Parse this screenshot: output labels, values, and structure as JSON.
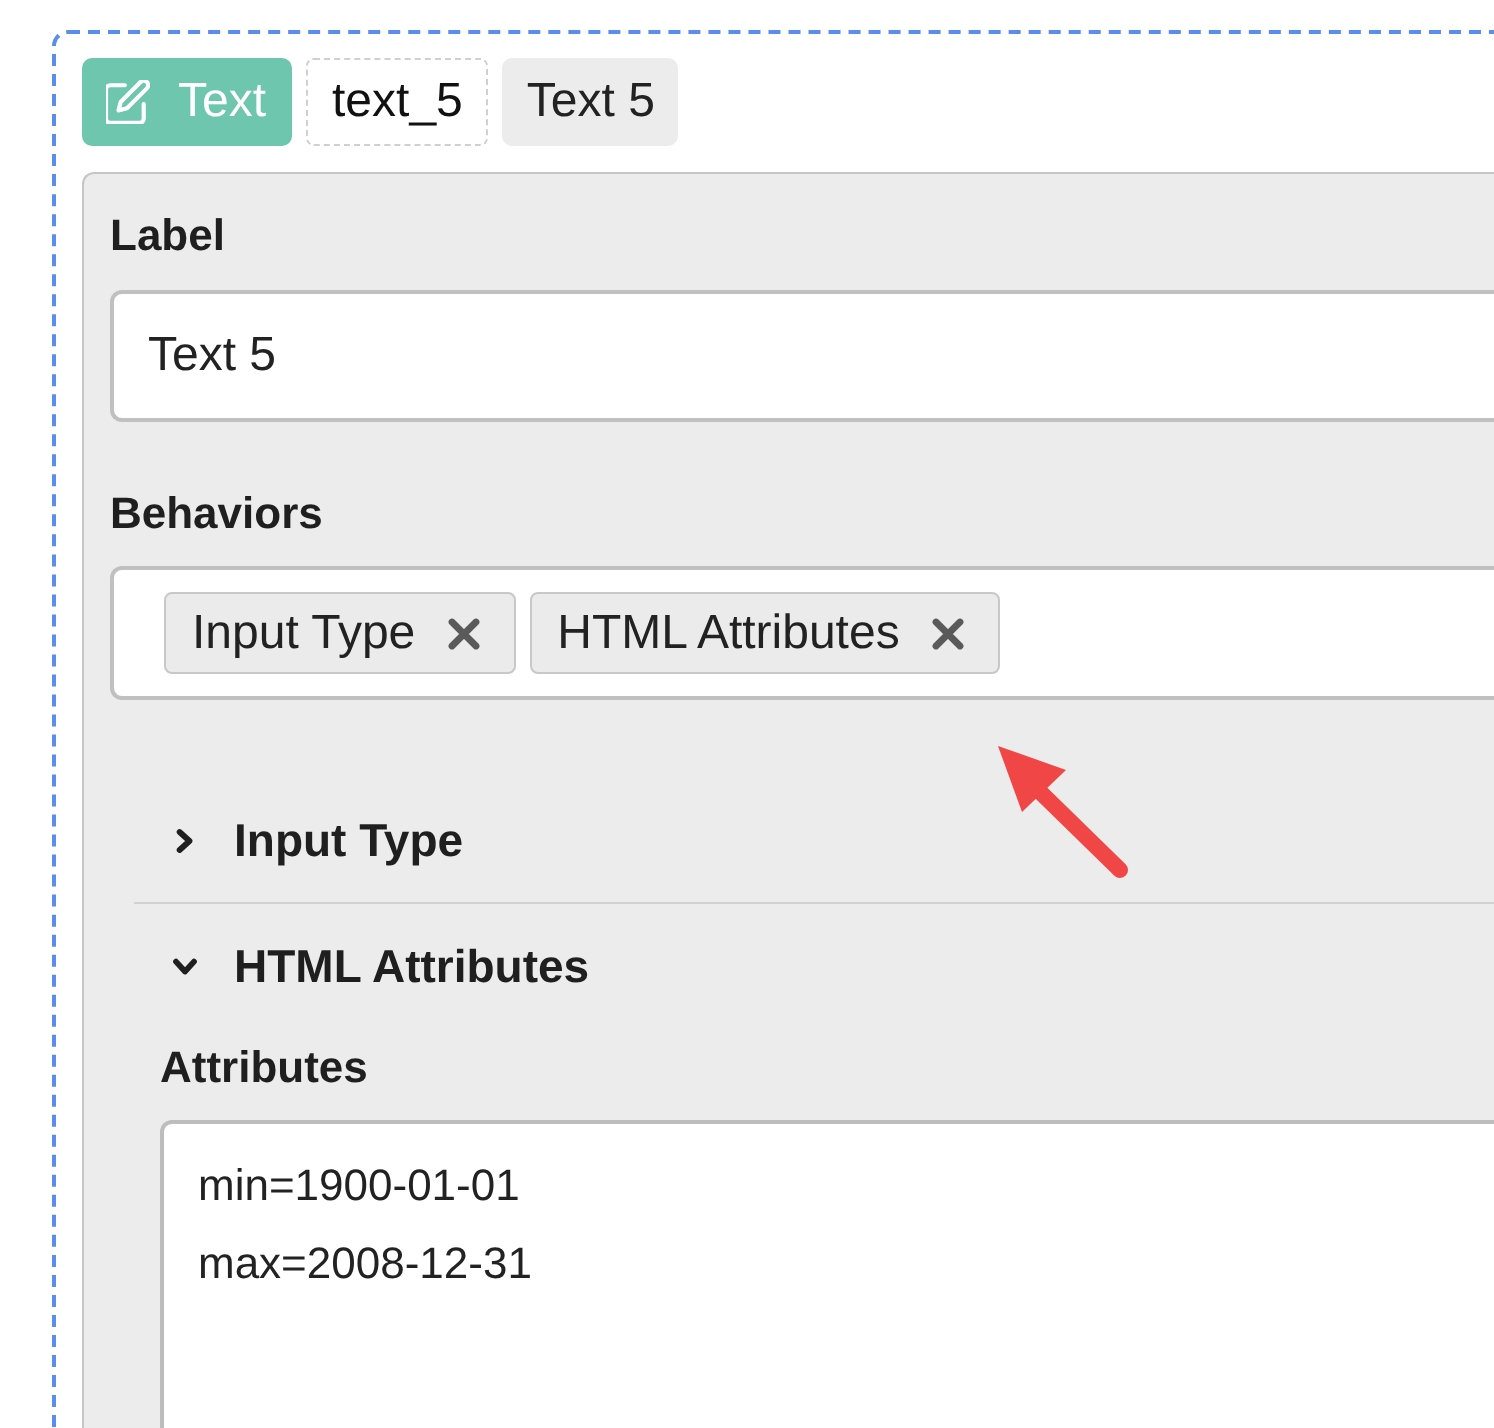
{
  "header": {
    "type_button": {
      "label": "Text"
    },
    "key_field": {
      "value": "text_5"
    },
    "name_chip": {
      "label": "Text 5"
    }
  },
  "panel": {
    "label_field": {
      "label": "Label",
      "value": "Text 5"
    },
    "behaviors": {
      "label": "Behaviors",
      "chips": [
        {
          "label": "Input Type"
        },
        {
          "label": "HTML Attributes"
        }
      ]
    },
    "sections": [
      {
        "title": "Input Type",
        "expanded": false
      },
      {
        "title": "HTML Attributes",
        "expanded": true,
        "fields": [
          {
            "label": "Attributes",
            "value": "min=1900-01-01\nmax=2008-12-31"
          }
        ]
      }
    ]
  }
}
